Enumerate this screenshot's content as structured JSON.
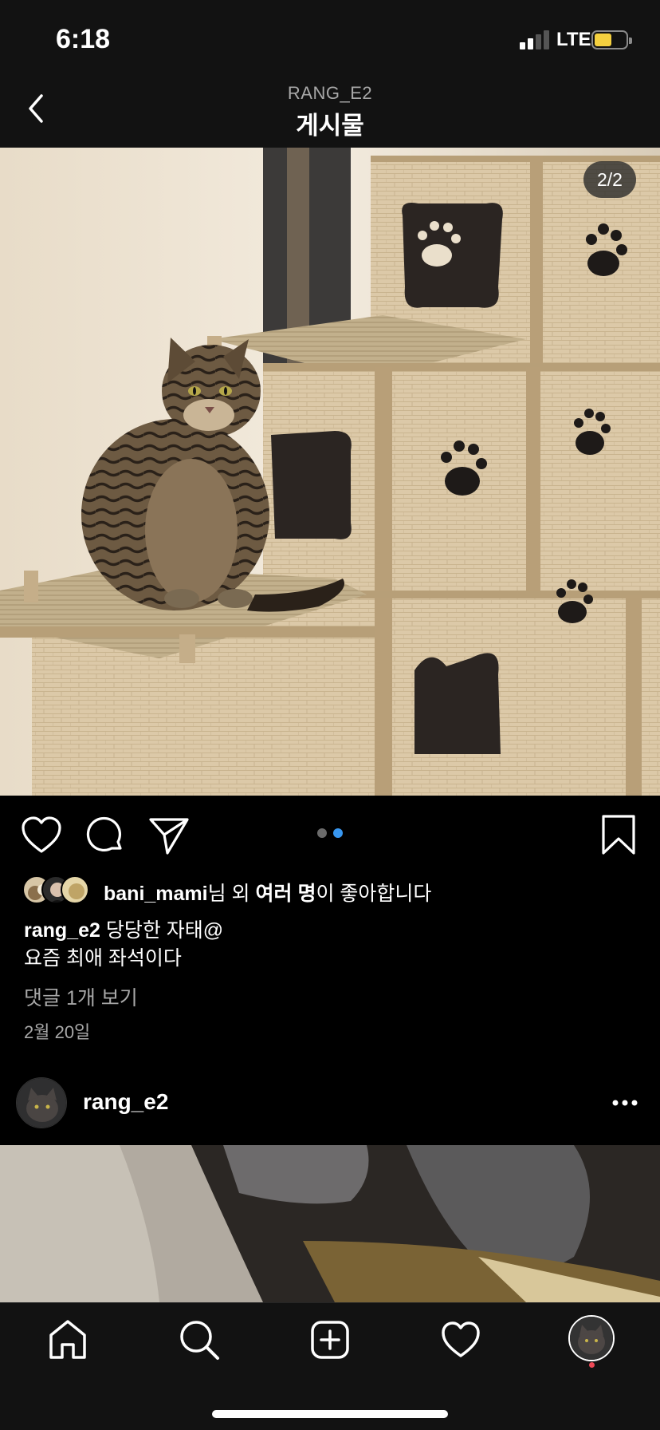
{
  "status_bar": {
    "time": "6:18",
    "network": "LTE",
    "signal_bars": 2,
    "battery_level": 0.55,
    "battery_color": "#f4d03f"
  },
  "nav": {
    "username_header": "RANG_E2",
    "title": "게시물",
    "back_icon": "chevron-left-icon"
  },
  "post": {
    "image_counter": "2/2",
    "image_description": "Tabby cat sitting on a cardboard cat house with paw-print cutouts",
    "carousel_active_index": 1,
    "carousel_count": 2,
    "carousel_active_color": "#3897f0",
    "carousel_inactive_color": "#6b6b6b",
    "action_icons": [
      "heart-icon",
      "comment-icon",
      "send-icon",
      "bookmark-icon"
    ],
    "likes": {
      "user": "bani_mami",
      "suffix1": "님 외 ",
      "others": "여러 명",
      "suffix2": "이 좋아합니다"
    },
    "caption": {
      "user": "rang_e2",
      "line1": " 당당한 자태@",
      "line2": "요즘 최애 좌석이다"
    },
    "comments_link": "댓글 1개 보기",
    "date": "2월 20일"
  },
  "next_post": {
    "user": "rang_e2",
    "more_icon": "more-horizontal-icon"
  },
  "tab_bar": {
    "tabs": [
      "home-icon",
      "search-icon",
      "add-post-icon",
      "activity-heart-icon",
      "profile-avatar"
    ],
    "notification_dot_color": "#ed4956"
  }
}
